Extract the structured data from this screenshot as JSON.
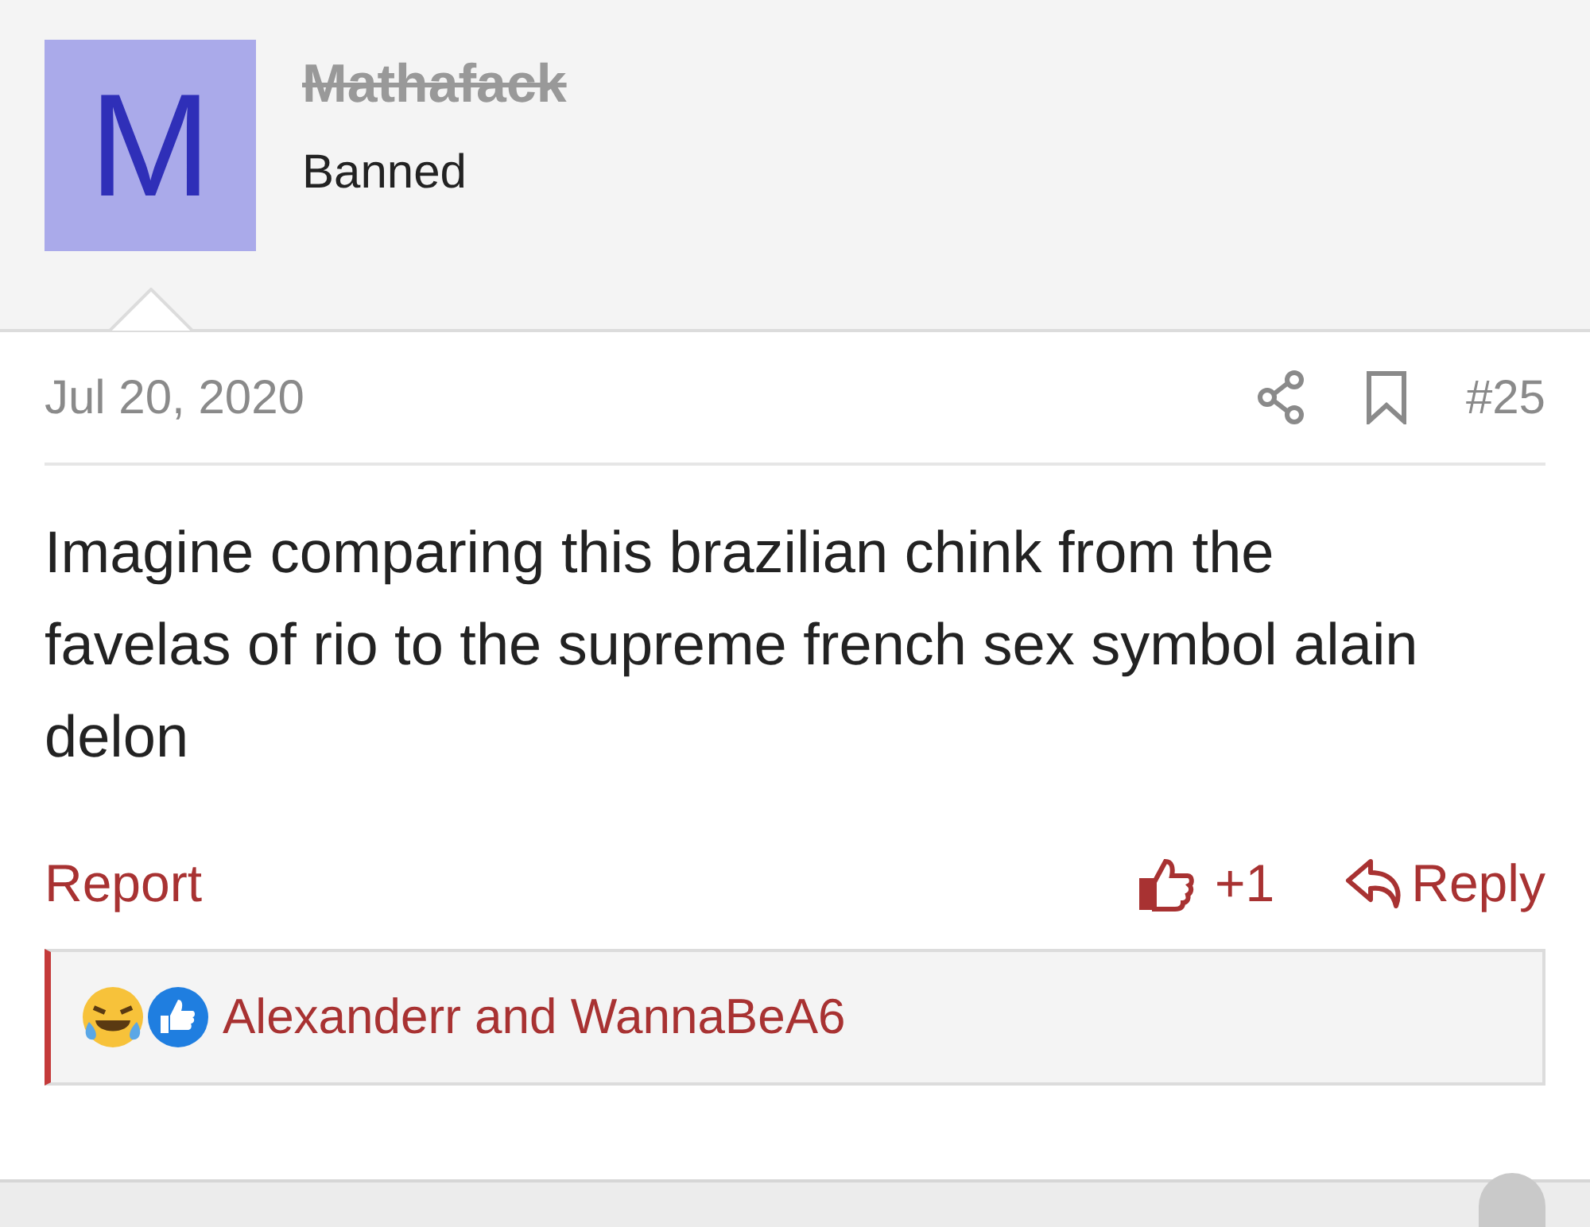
{
  "author": {
    "avatar_letter": "M",
    "username": "Mathafack",
    "struck": true,
    "title": "Banned"
  },
  "post": {
    "date": "Jul 20, 2020",
    "number": "#25",
    "body": "Imagine comparing this brazilian chink from the favelas of rio to the supreme french sex symbol alain delon"
  },
  "actions": {
    "report": "Report",
    "like_count": "+1",
    "reply": "Reply"
  },
  "reactions": {
    "users": "Alexanderr and WannaBeA6"
  }
}
